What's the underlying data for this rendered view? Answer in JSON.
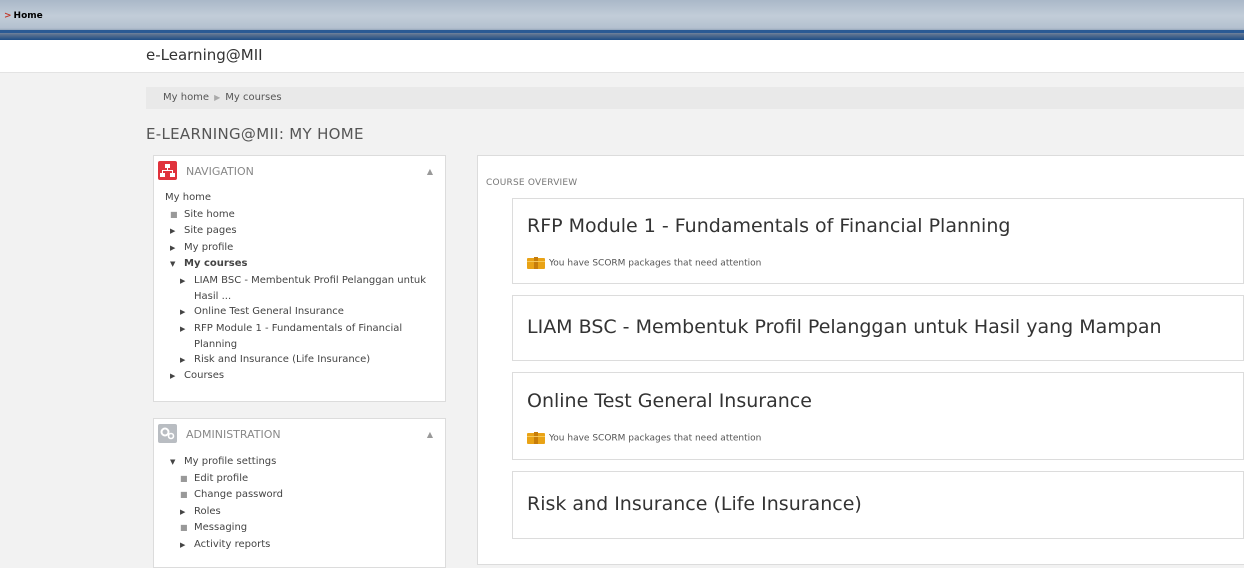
{
  "topbar": {
    "home_label": "Home"
  },
  "site": {
    "name": "e-Learning@MII"
  },
  "breadcrumb": {
    "items": [
      "My home",
      "My courses"
    ]
  },
  "page": {
    "title": "E-LEARNING@MII: MY HOME"
  },
  "navigation": {
    "title": "NAVIGATION",
    "root": "My home",
    "site_home": "Site home",
    "site_pages": "Site pages",
    "my_profile": "My profile",
    "my_courses": "My courses",
    "course1_l1": "LIAM BSC - Membentuk Profil Pelanggan untuk",
    "course1_l2": "Hasil ...",
    "course2": "Online Test General Insurance",
    "course3_l1": "RFP Module 1 - Fundamentals of Financial",
    "course3_l2": "Planning",
    "course4": "Risk and Insurance (Life Insurance)",
    "courses": "Courses"
  },
  "administration": {
    "title": "ADMINISTRATION",
    "profile_settings": "My profile settings",
    "edit_profile": "Edit profile",
    "change_password": "Change password",
    "roles": "Roles",
    "messaging": "Messaging",
    "activity_reports": "Activity reports"
  },
  "overview": {
    "title": "COURSE OVERVIEW",
    "courses": [
      {
        "title": "RFP Module 1 - Fundamentals of Financial Planning",
        "notice": "You have SCORM packages that need attention"
      },
      {
        "title": "LIAM BSC - Membentuk Profil Pelanggan untuk Hasil yang Mampan"
      },
      {
        "title": "Online Test General Insurance",
        "notice": "You have SCORM packages that need attention"
      },
      {
        "title": "Risk and Insurance (Life Insurance)"
      }
    ]
  },
  "colors": {
    "nav_icon": "#e0323c",
    "admin_icon": "#b9bdc2",
    "scorm_icon": "#e9a316"
  }
}
